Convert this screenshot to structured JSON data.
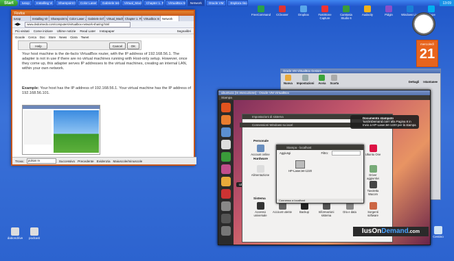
{
  "taskbar": {
    "start_label": "Start",
    "tasks": [
      "Iusop",
      "Installing Vi",
      "Sharepoint tw",
      "Color Laser J",
      "Gabriele Iest",
      "Virtual_Mach",
      "Chapter 1. Fi",
      "VirtualBox Ma",
      "Network",
      "Oracle VM",
      "Esplora risor"
    ],
    "tray_time": "13:09"
  },
  "desktop_top_icons": [
    "FreeCommand",
    "CCleaner",
    "Dropbox",
    "FastStone Capture",
    "Camtasia Studio 6",
    "Audacity",
    "Pidgin",
    "Windows Live",
    "Skype"
  ],
  "calendar": {
    "day_name": "mercoledì",
    "day_number": "21"
  },
  "desktop_bottom_icons": [
    "dationdrive",
    "podcast"
  ],
  "desktop_right_icon": "Cestino",
  "firefox": {
    "title": "Firefox",
    "tabs": [
      "Iusop",
      "Installing Vir",
      "Sharepoint tw",
      "Color Laser J",
      "Gabriele rief",
      "Virtual_Mach",
      "Chapter 1. Fi",
      "Virtualbox m",
      "Network"
    ],
    "url": "www.dedoimedo.com/computers/virtualbox-network-sharing.html",
    "bookmarks": [
      "Più visitati",
      "Come iniziare",
      "Ultime notizie",
      "Read Later",
      "Instapaper",
      "Segnalibri"
    ],
    "toolbar": [
      "Google",
      "Cerca",
      "Doc",
      "Store",
      "News",
      "Cipra",
      "Tweet"
    ],
    "dialog": {
      "help_label": "Help",
      "cancel_label": "Cancel",
      "ok_label": "OK"
    },
    "para1": "Your host machine is the de-facto VirtualBox router, with the IP address of 192.168.56.1. The adapter is not in use if there are no virtual machines running with Host-only setup. However, once they come up, this adapter serves IP addresses to the virtual machines, creating an internal LAN, within your own network.",
    "para2_label": "Example:",
    "para2": "Your host has the IP address of 192.168.56.1. Your virtual machine has the IP address of 192.168.56.101.",
    "findbar": {
      "label": "Trova:",
      "value": "pulsan re",
      "next": "Successivo",
      "prev": "Precedente",
      "highlight": "Evidenzia",
      "matchcase": "Maiuscole/minuscole"
    }
  },
  "virtualbox": {
    "title": "Oracle VM VirtualBox Gestore",
    "toolbar": [
      "Nuova",
      "Impostazioni",
      "Avvia",
      "Scarta"
    ],
    "right_buttons": [
      "Dettagli",
      "Istantanee"
    ]
  },
  "ubuntu": {
    "vm_title": "ubuntu11 [In esecuzione] - Oracle VM VirtualBox",
    "panel_label": "Stampa",
    "tooltip": "Ubuntu One",
    "sysset_title": "Impostazioni di sistema",
    "sysset_header": "Connessioni Windows su iacel",
    "section_personal": "Personale",
    "section_hardware": "Hardware",
    "section_system": "Sistema",
    "personal_icons": [
      "Account online",
      "Ubuntu One"
    ],
    "hardware_icons": [
      "Alimentazione",
      "Driver aggiuntivi",
      "Tavoletta Wacom"
    ],
    "system_icons": [
      "Accesso universale",
      "Account utente",
      "Backup",
      "Informazioni sistema",
      "Ora e data",
      "Sorgenti software"
    ],
    "printer": {
      "title": "Stampa - localhost",
      "add_label": "Aggiungi",
      "filter_label": "Filtro:",
      "printer_name": "HP-LaserJet-1220",
      "footer": "Connesso a localhost"
    },
    "notification": {
      "title": "Documento stampato",
      "body": "'IusOnDemand.com' alla Pagina 8 in Invio a HP-LaserJet-1220 per la stampa"
    }
  },
  "banner": {
    "part1": "IusOn",
    "part2": "Demand",
    "part3": ".com"
  }
}
